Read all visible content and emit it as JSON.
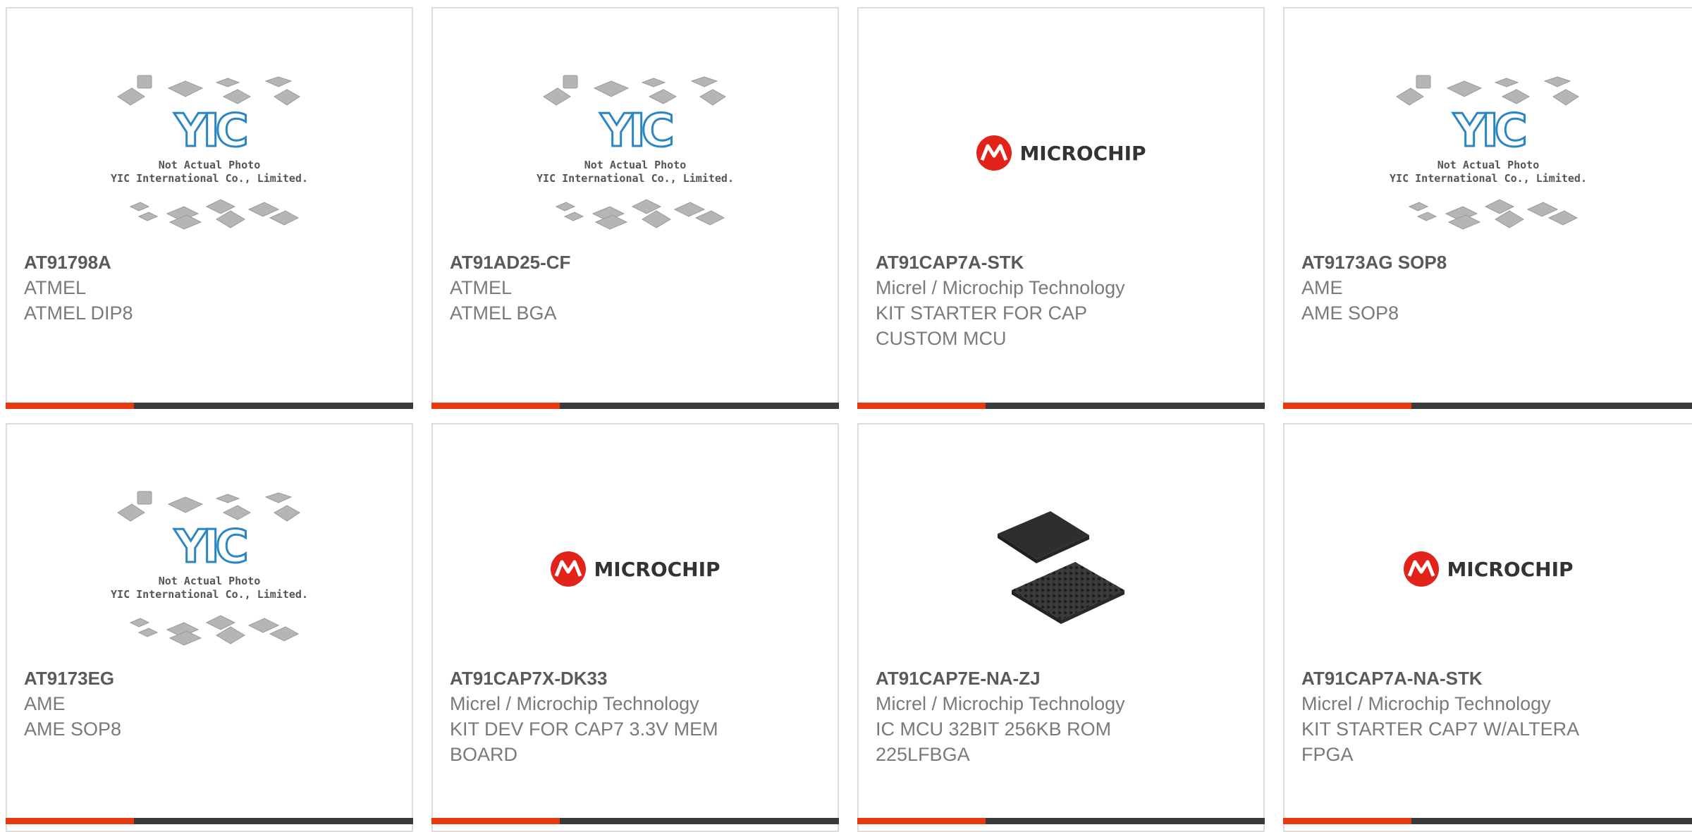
{
  "products": [
    {
      "part": "AT91798A",
      "manufacturer": "ATMEL",
      "description": "ATMEL DIP8",
      "image": "yic-placeholder"
    },
    {
      "part": "AT91AD25-CF",
      "manufacturer": "ATMEL",
      "description": "ATMEL BGA",
      "image": "yic-placeholder"
    },
    {
      "part": "AT91CAP7A-STK",
      "manufacturer": "Micrel / Microchip Technology",
      "description": "KIT STARTER FOR CAP CUSTOM MCU",
      "image": "microchip-logo"
    },
    {
      "part": "AT9173AG SOP8",
      "manufacturer": "AME",
      "description": "AME SOP8",
      "image": "yic-placeholder"
    },
    {
      "part": "AT9173EG",
      "manufacturer": "AME",
      "description": "AME SOP8",
      "image": "yic-placeholder"
    },
    {
      "part": "AT91CAP7X-DK33",
      "manufacturer": "Micrel / Microchip Technology",
      "description": "KIT DEV FOR CAP7 3.3V MEM BOARD",
      "image": "microchip-logo"
    },
    {
      "part": "AT91CAP7E-NA-ZJ",
      "manufacturer": "Micrel / Microchip Technology",
      "description": "IC MCU 32BIT 256KB ROM 225LFBGA",
      "image": "bga-chip-photo"
    },
    {
      "part": "AT91CAP7A-NA-STK",
      "manufacturer": "Micrel / Microchip Technology",
      "description": "KIT STARTER CAP7 W/ALTERA FPGA",
      "image": "microchip-logo"
    }
  ],
  "placeholder": {
    "logo_text": "YIC",
    "line1": "Not Actual Photo",
    "line2": "YIC International Co., Limited."
  },
  "brand": {
    "microchip_text": "MICROCHIP",
    "microchip_red": "#e2231a"
  },
  "colors": {
    "accent": "#e8380d",
    "bar": "#3a3a3a",
    "border": "#dcdcdc",
    "part_text": "#5a5a5a",
    "muted_text": "#7a7a7a"
  }
}
